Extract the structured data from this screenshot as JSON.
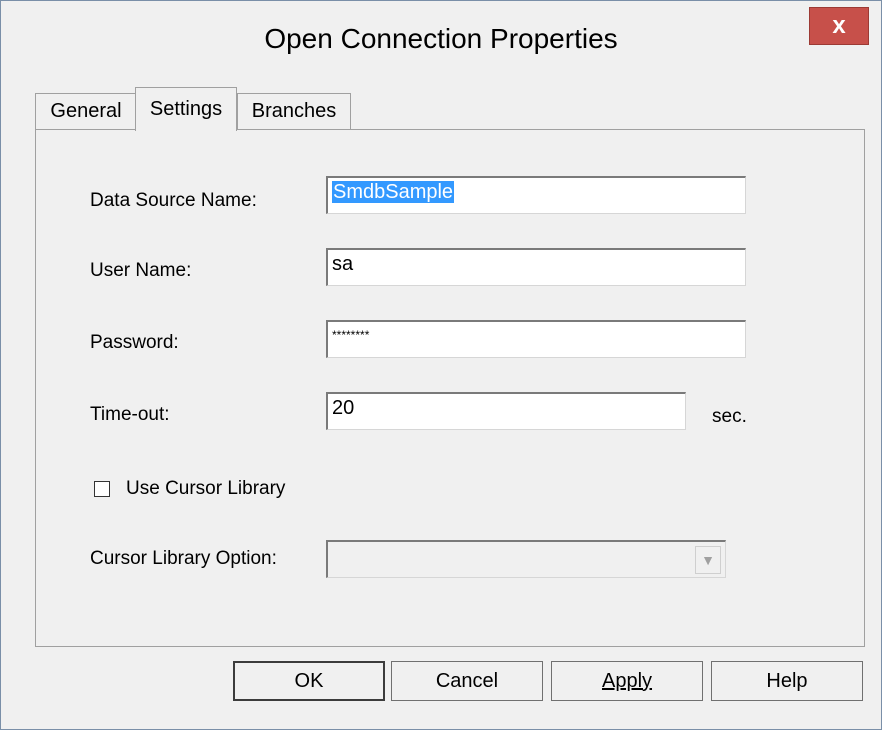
{
  "window": {
    "title": "Open Connection Properties",
    "close_glyph": "x"
  },
  "tabs": [
    {
      "label": "General",
      "active": false
    },
    {
      "label": "Settings",
      "active": true
    },
    {
      "label": "Branches",
      "active": false
    }
  ],
  "form": {
    "data_source_label": "Data Source Name:",
    "data_source_value": "SmdbSample",
    "user_name_label": "User Name:",
    "user_name_value": "sa",
    "password_label": "Password:",
    "password_value": "********",
    "timeout_label": "Time-out:",
    "timeout_value": "20",
    "timeout_unit": "sec.",
    "use_cursor_library_label": "Use Cursor Library",
    "use_cursor_library_checked": false,
    "cursor_library_option_label": "Cursor Library Option:",
    "cursor_library_option_value": ""
  },
  "buttons": {
    "ok": "OK",
    "cancel": "Cancel",
    "apply": "Apply",
    "help": "Help"
  },
  "colors": {
    "close_bg": "#c7504a",
    "selection": "#3399ff"
  }
}
